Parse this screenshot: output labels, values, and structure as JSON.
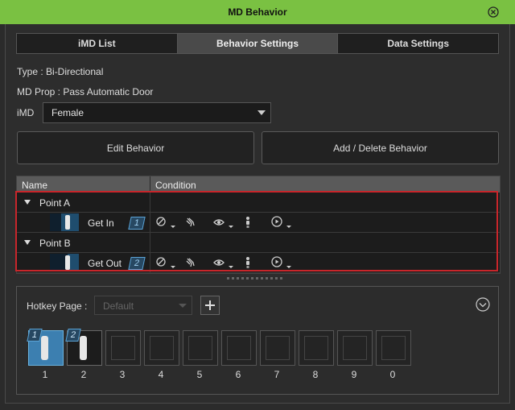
{
  "window": {
    "title": "MD Behavior"
  },
  "tabs": [
    {
      "label": "iMD List",
      "active": false
    },
    {
      "label": "Behavior Settings",
      "active": true
    },
    {
      "label": "Data Settings",
      "active": false
    }
  ],
  "info": {
    "type": "Type :  Bi-Directional",
    "md_prop": "MD Prop :  Pass Automatic Door",
    "imd_label": "iMD",
    "imd_value": "Female"
  },
  "buttons": {
    "edit": "Edit Behavior",
    "add_delete": "Add / Delete Behavior"
  },
  "table": {
    "col_name": "Name",
    "col_condition": "Condition",
    "groups": [
      {
        "name": "Point A",
        "item": {
          "label": "Get In",
          "badge": "1"
        }
      },
      {
        "name": "Point B",
        "item": {
          "label": "Get Out",
          "badge": "2"
        }
      }
    ]
  },
  "hotkey": {
    "label": "Hotkey Page :",
    "page_value": "Default",
    "slots": [
      "1",
      "2",
      "3",
      "4",
      "5",
      "6",
      "7",
      "8",
      "9",
      "0"
    ],
    "slot_badges": [
      "1",
      "2"
    ]
  },
  "colors": {
    "title_bar": "#7ac142",
    "highlight": "#c8262b",
    "badge": "#5aa3d6"
  }
}
